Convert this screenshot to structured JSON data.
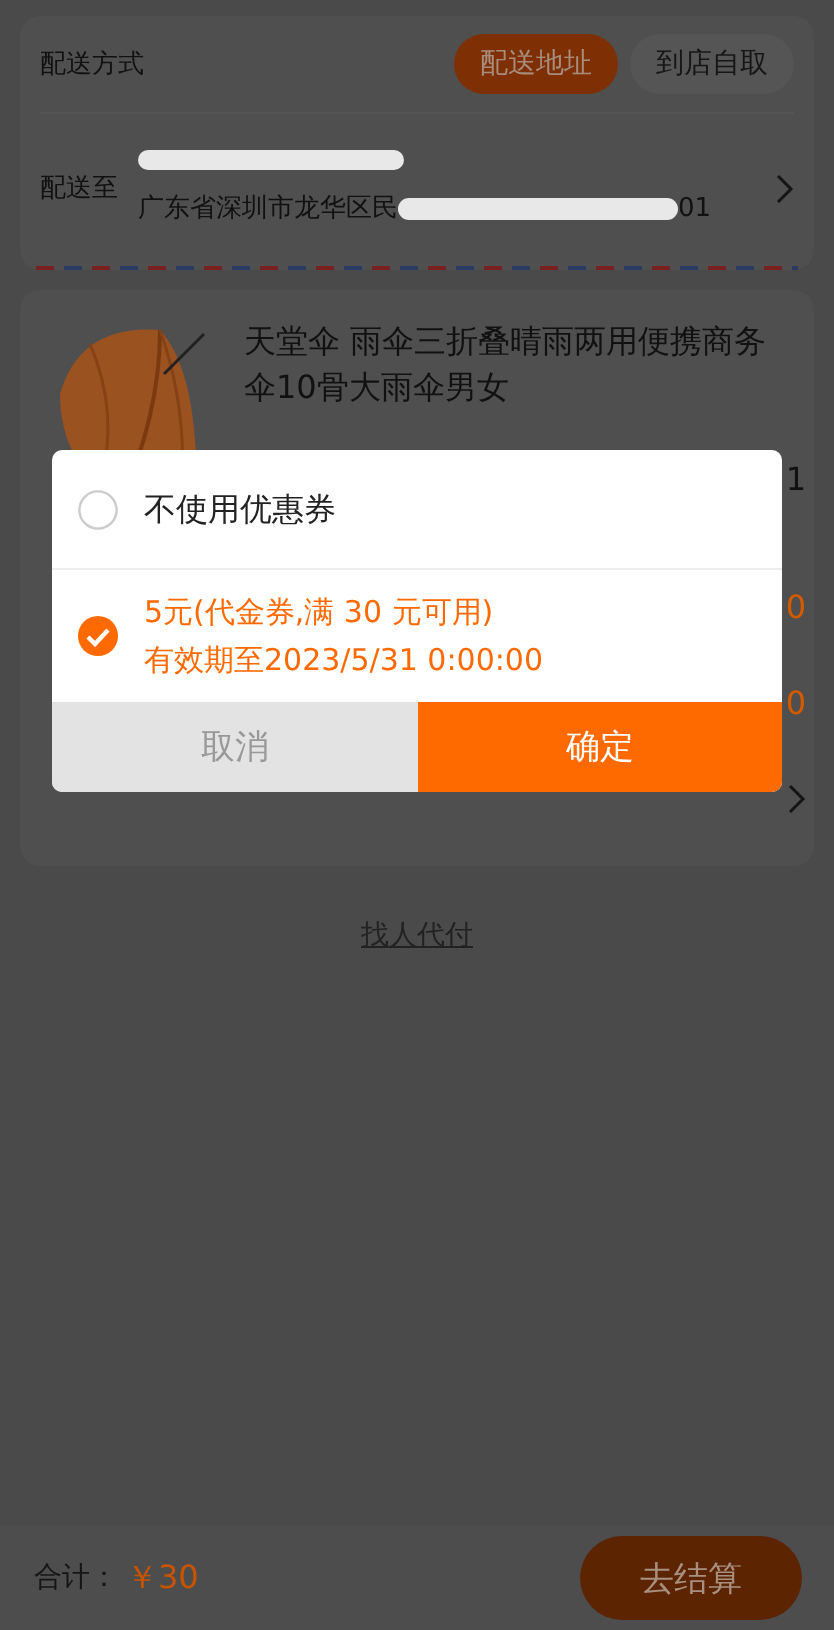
{
  "delivery": {
    "label": "配送方式",
    "options": [
      {
        "label": "配送地址",
        "selected": true
      },
      {
        "label": "到店自取",
        "selected": false
      }
    ]
  },
  "address": {
    "label": "配送至",
    "line_start": "广东省深圳市龙华区民",
    "line_end": "01"
  },
  "product": {
    "title": "天堂伞 雨伞三折叠晴雨两用便携商务伞10骨大雨伞男女",
    "price": "1"
  },
  "summary_rows": [
    {
      "kind": "value",
      "value": "0"
    },
    {
      "kind": "value",
      "value": "0"
    },
    {
      "kind": "chevron"
    }
  ],
  "pay_for_me": "找人代付",
  "footer": {
    "total_label": "合计：",
    "total": "￥30",
    "checkout": "去结算"
  },
  "coupon_dialog": {
    "options": [
      {
        "lines": [
          "不使用优惠券"
        ],
        "selected": false
      },
      {
        "lines": [
          "5元(代金券,满 30 元可用)",
          "有效期至2023/5/31 0:00:00"
        ],
        "selected": true
      }
    ],
    "cancel": "取消",
    "confirm": "确定"
  }
}
